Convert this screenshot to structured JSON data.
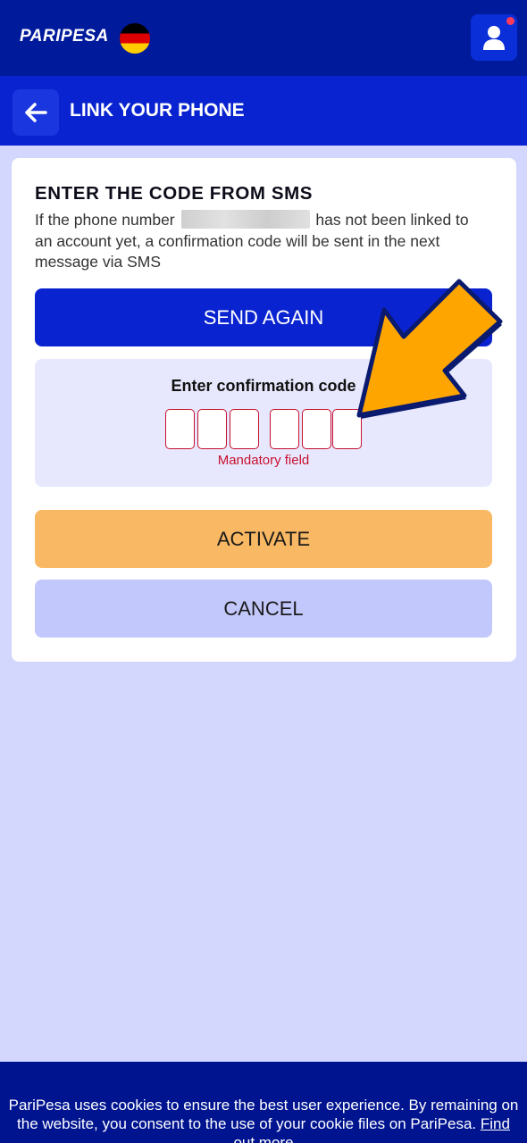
{
  "header": {
    "logo_text": "PARIPESA",
    "flag_icon": "germany-flag-icon",
    "user_icon": "user-icon"
  },
  "title_bar": {
    "back_icon": "arrow-left-icon",
    "title": "LINK YOUR PHONE"
  },
  "card": {
    "heading": "ENTER THE CODE FROM SMS",
    "desc_before": "If the phone number",
    "desc_after": "has not been linked to an account yet, a confirmation code will be sent in the next message via SMS",
    "send_again_label": "SEND AGAIN",
    "code_label": "Enter confirmation code",
    "code_digits": [
      "",
      "",
      "",
      "",
      "",
      ""
    ],
    "mandatory_text": "Mandatory field",
    "activate_label": "ACTIVATE",
    "cancel_label": "CANCEL"
  },
  "cookie_banner": {
    "text": "PariPesa uses cookies to ensure the best user experience. By remaining on the website, you consent to the use of your cookie files on PariPesa.",
    "link_text": "Find out more"
  },
  "colors": {
    "topbar": "#001a9c",
    "titlebar": "#0a23d0",
    "background": "#d3d6fd",
    "activate": "#f9b863",
    "cancel": "#c3c8fc",
    "error": "#c8102e",
    "annotation_arrow": "#ffa500"
  }
}
